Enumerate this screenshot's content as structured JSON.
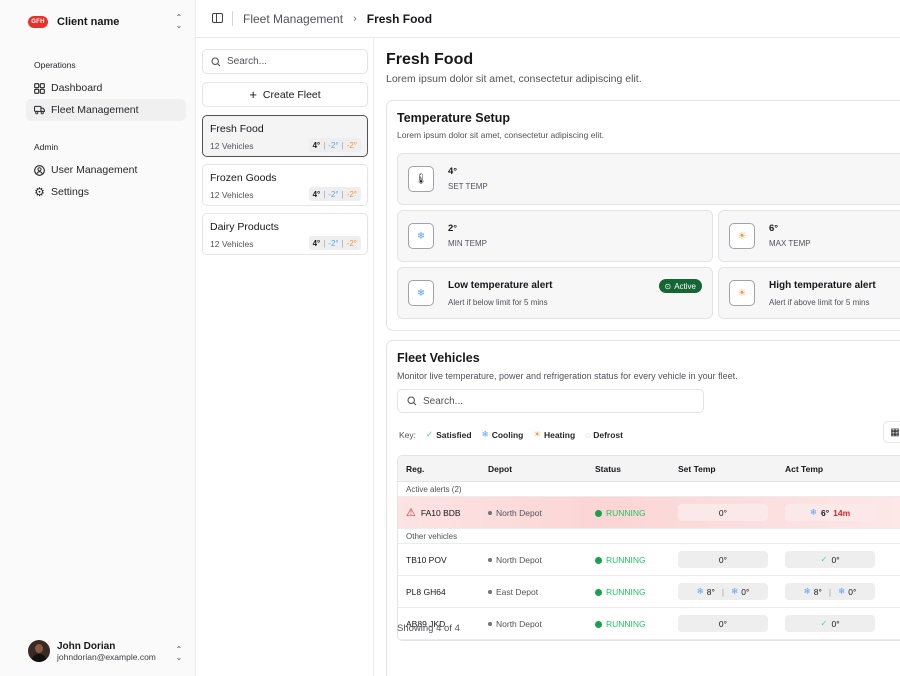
{
  "sidebar": {
    "brand": {
      "logo_text": "GFH",
      "name": "Client name"
    },
    "operations_label": "Operations",
    "operations": [
      {
        "label": "Dashboard",
        "icon": "grid-icon"
      },
      {
        "label": "Fleet Management",
        "icon": "truck-icon",
        "active": true
      }
    ],
    "admin_label": "Admin",
    "admin": [
      {
        "label": "User Management",
        "icon": "user-circle-icon"
      },
      {
        "label": "Settings",
        "icon": "gear-icon"
      }
    ],
    "user": {
      "name": "John Dorian",
      "email": "johndorian@example.com"
    }
  },
  "topbar": {
    "crumb_parent": "Fleet Management",
    "crumb_current": "Fresh Food"
  },
  "fleet_list": {
    "search_placeholder": "Search...",
    "create_label": "Create Fleet",
    "fleets": [
      {
        "name": "Fresh Food",
        "vehicles": "12 Vehicles",
        "set": "4°",
        "min": "-2°",
        "max": "-2°"
      },
      {
        "name": "Frozen Goods",
        "vehicles": "12 Vehicles",
        "set": "4°",
        "min": "-2°",
        "max": "-2°"
      },
      {
        "name": "Dairy Products",
        "vehicles": "12 Vehicles",
        "set": "4°",
        "min": "-2°",
        "max": "-2°"
      }
    ]
  },
  "main": {
    "title": "Fresh Food",
    "subtitle": "Lorem ipsum dolor sit amet, consectetur adipiscing elit.",
    "temp_setup": {
      "title": "Temperature Setup",
      "subtitle": "Lorem ipsum dolor sit amet, consectetur adipiscing elit.",
      "set_value": "4°",
      "set_label": "SET TEMP",
      "min_value": "2°",
      "min_label": "MIN TEMP",
      "max_value": "6°",
      "max_label": "MAX TEMP",
      "low_title": "Low temperature alert",
      "low_desc": "Alert if below limit for 5 mins",
      "low_badge": "Active",
      "high_title": "High temperature alert",
      "high_desc": "Alert if above limit for 5 mins"
    },
    "vehicles": {
      "title": "Fleet Vehicles",
      "subtitle": "Monitor live temperature, power and refrigeration status for every vehicle in your fleet.",
      "search_placeholder": "Search...",
      "key_label": "Key:",
      "key": {
        "satisfied": "Satisfied",
        "cooling": "Cooling",
        "heating": "Heating",
        "defrost": "Defrost"
      },
      "columns": {
        "reg": "Reg.",
        "depot": "Depot",
        "status": "Status",
        "set_temp": "Set Temp",
        "act_temp": "Act Temp"
      },
      "active_group": "Active alerts (2)",
      "other_group": "Other vehicles",
      "alert_row": {
        "reg": "FA10 BDB",
        "depot": "North Depot",
        "status": "RUNNING",
        "set": "0°",
        "act": "6°",
        "act_time": "14m"
      },
      "rows": [
        {
          "reg": "TB10 POV",
          "depot": "North Depot",
          "status": "RUNNING",
          "set": "0°",
          "act": "0°"
        },
        {
          "reg": "PL8 GH64",
          "depot": "East Depot",
          "status": "RUNNING",
          "set_a": "8°",
          "set_b": "0°",
          "act_a": "8°",
          "act_b": "0°"
        },
        {
          "reg": "AB89 JKD",
          "depot": "North Depot",
          "status": "RUNNING",
          "set": "0°",
          "act": "0°"
        }
      ],
      "showing": "Showing 4 of 4"
    }
  },
  "colors": {
    "accent_red": "#e5322d",
    "success": "#16a34a",
    "cooling": "#60a5fa",
    "heating": "#fb923c"
  }
}
